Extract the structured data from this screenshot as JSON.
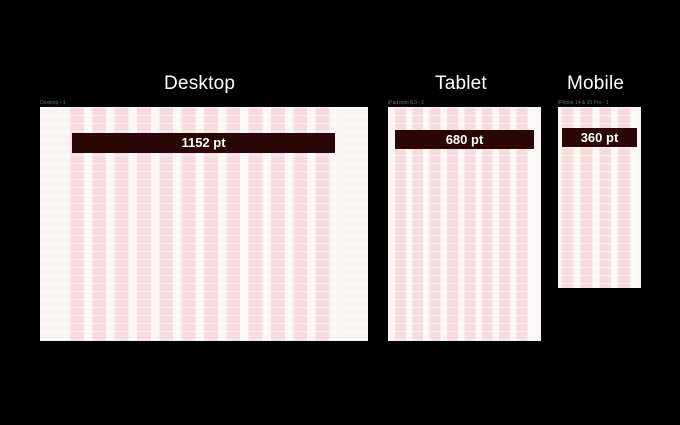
{
  "colors": {
    "background": "#000000",
    "frame_bg": "#fbf4f4",
    "column": "#f6dcdf",
    "gutter": "#fdf6f6",
    "bar": "#2a0606",
    "heading_text": "#ffffff",
    "frame_label_text": "#6f6f6f"
  },
  "desktop": {
    "heading": "Desktop",
    "frame_label": "Desktop - 1",
    "width_label": "1152 pt",
    "columns": 12
  },
  "tablet": {
    "heading": "Tablet",
    "frame_label": "iPad mini 8.3 - 1",
    "width_label": "680 pt",
    "columns": 8
  },
  "mobile": {
    "heading": "Mobile",
    "frame_label": "iPhone 14 & 15 Pro - 1",
    "width_label": "360 pt",
    "columns": 4
  }
}
